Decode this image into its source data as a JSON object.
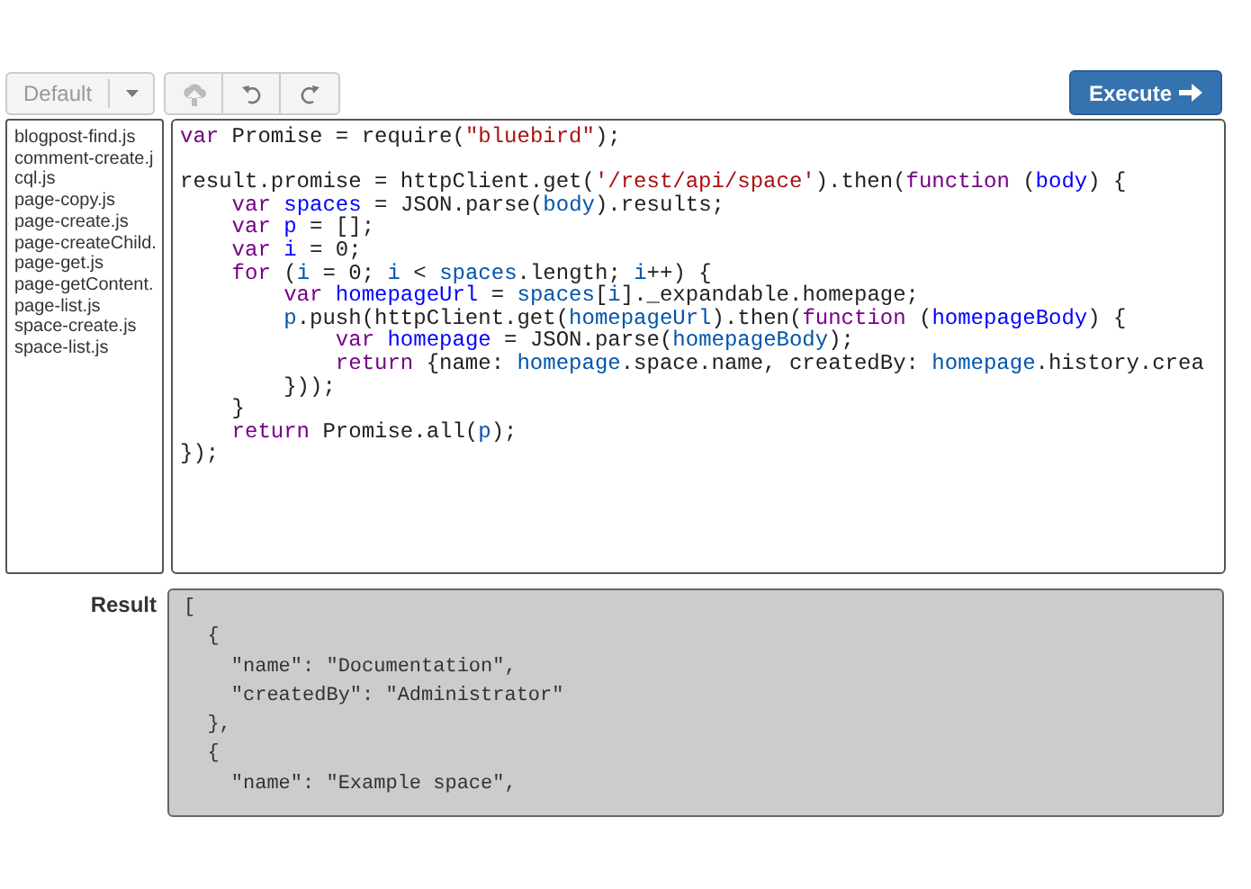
{
  "toolbar": {
    "preset_button": "Default",
    "execute_button": "Execute"
  },
  "files": [
    "blogpost-find.js",
    "comment-create.j",
    "cql.js",
    "page-copy.js",
    "page-create.js",
    "page-createChild.",
    "page-get.js",
    "page-getContent.",
    "page-list.js",
    "space-create.js",
    "space-list.js"
  ],
  "editor": {
    "lines": [
      {
        "tokens": [
          {
            "text": "var",
            "kind": "keyword"
          },
          {
            "text": " Promise = require(",
            "kind": "plain"
          },
          {
            "text": "\"bluebird\"",
            "kind": "string"
          },
          {
            "text": ");",
            "kind": "plain"
          }
        ]
      },
      {
        "blank_before": true,
        "tokens": [
          {
            "text": "result.promise = httpClient.get(",
            "kind": "plain"
          },
          {
            "text": "'/rest/api/space'",
            "kind": "string"
          },
          {
            "text": ").then(",
            "kind": "plain"
          },
          {
            "text": "function",
            "kind": "keyword"
          },
          {
            "text": " (",
            "kind": "plain"
          },
          {
            "text": "body",
            "kind": "def"
          },
          {
            "text": ") {",
            "kind": "plain"
          }
        ]
      },
      {
        "tokens": [
          {
            "text": "    var",
            "kind": "keyword"
          },
          {
            "text": " spaces",
            "kind": "def"
          },
          {
            "text": " = JSON.parse(",
            "kind": "plain"
          },
          {
            "text": "body",
            "kind": "variable"
          },
          {
            "text": ").results;",
            "kind": "plain"
          }
        ]
      },
      {
        "tokens": [
          {
            "text": "    var",
            "kind": "keyword"
          },
          {
            "text": " p",
            "kind": "def"
          },
          {
            "text": " = [];",
            "kind": "plain"
          }
        ]
      },
      {
        "tokens": [
          {
            "text": "    var",
            "kind": "keyword"
          },
          {
            "text": " i",
            "kind": "def"
          },
          {
            "text": " = 0;",
            "kind": "plain"
          }
        ]
      },
      {
        "tokens": [
          {
            "text": "    for",
            "kind": "keyword"
          },
          {
            "text": " (",
            "kind": "plain"
          },
          {
            "text": "i",
            "kind": "variable"
          },
          {
            "text": " = 0; ",
            "kind": "plain"
          },
          {
            "text": "i",
            "kind": "variable"
          },
          {
            "text": " < ",
            "kind": "plain"
          },
          {
            "text": "spaces",
            "kind": "variable"
          },
          {
            "text": ".length; ",
            "kind": "plain"
          },
          {
            "text": "i",
            "kind": "variable"
          },
          {
            "text": "++) {",
            "kind": "plain"
          }
        ]
      },
      {
        "tokens": [
          {
            "text": "        var",
            "kind": "keyword"
          },
          {
            "text": " homepageUrl",
            "kind": "def"
          },
          {
            "text": " = ",
            "kind": "plain"
          },
          {
            "text": "spaces",
            "kind": "variable"
          },
          {
            "text": "[",
            "kind": "plain"
          },
          {
            "text": "i",
            "kind": "variable"
          },
          {
            "text": "]._expandable.homepage;",
            "kind": "plain"
          }
        ]
      },
      {
        "tokens": [
          {
            "text": "        p",
            "kind": "variable"
          },
          {
            "text": ".push(httpClient.get(",
            "kind": "plain"
          },
          {
            "text": "homepageUrl",
            "kind": "variable"
          },
          {
            "text": ").then(",
            "kind": "plain"
          },
          {
            "text": "function",
            "kind": "keyword"
          },
          {
            "text": " (",
            "kind": "plain"
          },
          {
            "text": "homepageBody",
            "kind": "def"
          },
          {
            "text": ") {",
            "kind": "plain"
          }
        ]
      },
      {
        "tokens": [
          {
            "text": "            var",
            "kind": "keyword"
          },
          {
            "text": " homepage",
            "kind": "def"
          },
          {
            "text": " = JSON.parse(",
            "kind": "plain"
          },
          {
            "text": "homepageBody",
            "kind": "variable"
          },
          {
            "text": ");",
            "kind": "plain"
          }
        ]
      },
      {
        "tokens": [
          {
            "text": "            return",
            "kind": "keyword"
          },
          {
            "text": " {name: ",
            "kind": "plain"
          },
          {
            "text": "homepage",
            "kind": "variable"
          },
          {
            "text": ".space.name, createdBy: ",
            "kind": "plain"
          },
          {
            "text": "homepage",
            "kind": "variable"
          },
          {
            "text": ".history.crea",
            "kind": "plain"
          }
        ]
      },
      {
        "tokens": [
          {
            "text": "        }));",
            "kind": "plain"
          }
        ]
      },
      {
        "tokens": [
          {
            "text": "    }",
            "kind": "plain"
          }
        ]
      },
      {
        "tokens": [
          {
            "text": "    return",
            "kind": "keyword"
          },
          {
            "text": " Promise.all(",
            "kind": "plain"
          },
          {
            "text": "p",
            "kind": "variable"
          },
          {
            "text": ");",
            "kind": "plain"
          }
        ]
      },
      {
        "tokens": [
          {
            "text": "});",
            "kind": "plain"
          }
        ]
      }
    ]
  },
  "result": {
    "label": "Result",
    "lines": [
      "[",
      "  {",
      "    \"name\": \"Documentation\",",
      "    \"createdBy\": \"Administrator\"",
      "  },",
      "  {",
      "    \"name\": \"Example space\","
    ]
  }
}
